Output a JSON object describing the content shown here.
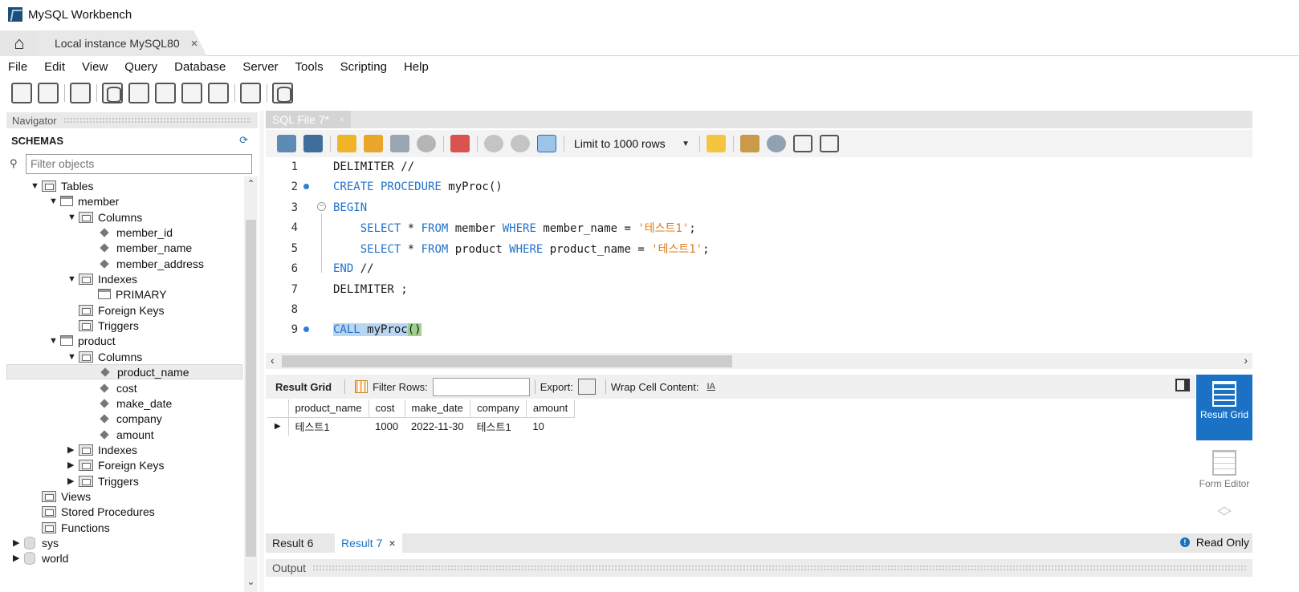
{
  "window": {
    "title": "MySQL Workbench"
  },
  "connection_tab": {
    "label": "Local instance MySQL80",
    "close": "×"
  },
  "menu": [
    "File",
    "Edit",
    "View",
    "Query",
    "Database",
    "Server",
    "Tools",
    "Scripting",
    "Help"
  ],
  "navigator": {
    "header": "Navigator",
    "section": "SCHEMAS",
    "filter_placeholder": "Filter objects",
    "tree": [
      {
        "label": "Tables",
        "twisty": "▼",
        "icon": "folder-icon"
      },
      {
        "label": "member",
        "twisty": "▼",
        "icon": "table-icon"
      },
      {
        "label": "Columns",
        "twisty": "▼",
        "icon": "folder-icon"
      },
      {
        "label": "member_id",
        "twisty": "",
        "icon": "column-icon"
      },
      {
        "label": "member_name",
        "twisty": "",
        "icon": "column-icon"
      },
      {
        "label": "member_address",
        "twisty": "",
        "icon": "column-icon"
      },
      {
        "label": "Indexes",
        "twisty": "▼",
        "icon": "folder-icon"
      },
      {
        "label": "PRIMARY",
        "twisty": "",
        "icon": "index-icon"
      },
      {
        "label": "Foreign Keys",
        "twisty": "",
        "icon": "folder-icon"
      },
      {
        "label": "Triggers",
        "twisty": "",
        "icon": "folder-icon"
      },
      {
        "label": "product",
        "twisty": "▼",
        "icon": "table-icon"
      },
      {
        "label": "Columns",
        "twisty": "▼",
        "icon": "folder-icon"
      },
      {
        "label": "product_name",
        "twisty": "",
        "icon": "column-icon"
      },
      {
        "label": "cost",
        "twisty": "",
        "icon": "column-icon"
      },
      {
        "label": "make_date",
        "twisty": "",
        "icon": "column-icon"
      },
      {
        "label": "company",
        "twisty": "",
        "icon": "column-icon"
      },
      {
        "label": "amount",
        "twisty": "",
        "icon": "column-icon"
      },
      {
        "label": "Indexes",
        "twisty": "▶",
        "icon": "folder-icon"
      },
      {
        "label": "Foreign Keys",
        "twisty": "▶",
        "icon": "folder-icon"
      },
      {
        "label": "Triggers",
        "twisty": "▶",
        "icon": "folder-icon"
      },
      {
        "label": "Views",
        "twisty": "",
        "icon": "folder-icon"
      },
      {
        "label": "Stored Procedures",
        "twisty": "",
        "icon": "folder-icon"
      },
      {
        "label": "Functions",
        "twisty": "",
        "icon": "folder-icon"
      },
      {
        "label": "sys",
        "twisty": "▶",
        "icon": "database-icon"
      },
      {
        "label": "world",
        "twisty": "▶",
        "icon": "database-icon"
      }
    ]
  },
  "sql_tab": {
    "label": "SQL File 7*",
    "close": "×"
  },
  "sql_toolbar": {
    "limit_label": "Limit to 1000 rows"
  },
  "editor": {
    "lines": [
      {
        "n": "1",
        "text": "DELIMITER //"
      },
      {
        "n": "2",
        "text": "CREATE PROCEDURE myProc()"
      },
      {
        "n": "3",
        "text": "BEGIN"
      },
      {
        "n": "4",
        "text": "    SELECT * FROM member WHERE member_name = '테스트1';"
      },
      {
        "n": "5",
        "text": "    SELECT * FROM product WHERE product_name = '테스트1';"
      },
      {
        "n": "6",
        "text": "END //"
      },
      {
        "n": "7",
        "text": "DELIMITER ;"
      },
      {
        "n": "8",
        "text": ""
      },
      {
        "n": "9",
        "text": "CALL myProc()"
      }
    ]
  },
  "result_toolbar": {
    "result_grid": "Result Grid",
    "filter_rows": "Filter Rows:",
    "export": "Export:",
    "wrap": "Wrap Cell Content:",
    "wrap_glyph": "IA"
  },
  "result_grid": {
    "columns": [
      "product_name",
      "cost",
      "make_date",
      "company",
      "amount"
    ],
    "rows": [
      [
        "테스트1",
        "1000",
        "2022-11-30",
        "테스트1",
        "10"
      ]
    ]
  },
  "side_panel": {
    "result_grid": "Result Grid",
    "form_editor": "Form Editor"
  },
  "result_tabs": {
    "tab1": "Result 6",
    "tab2": "Result 7",
    "close": "×"
  },
  "read_only": "Read Only",
  "output": "Output"
}
